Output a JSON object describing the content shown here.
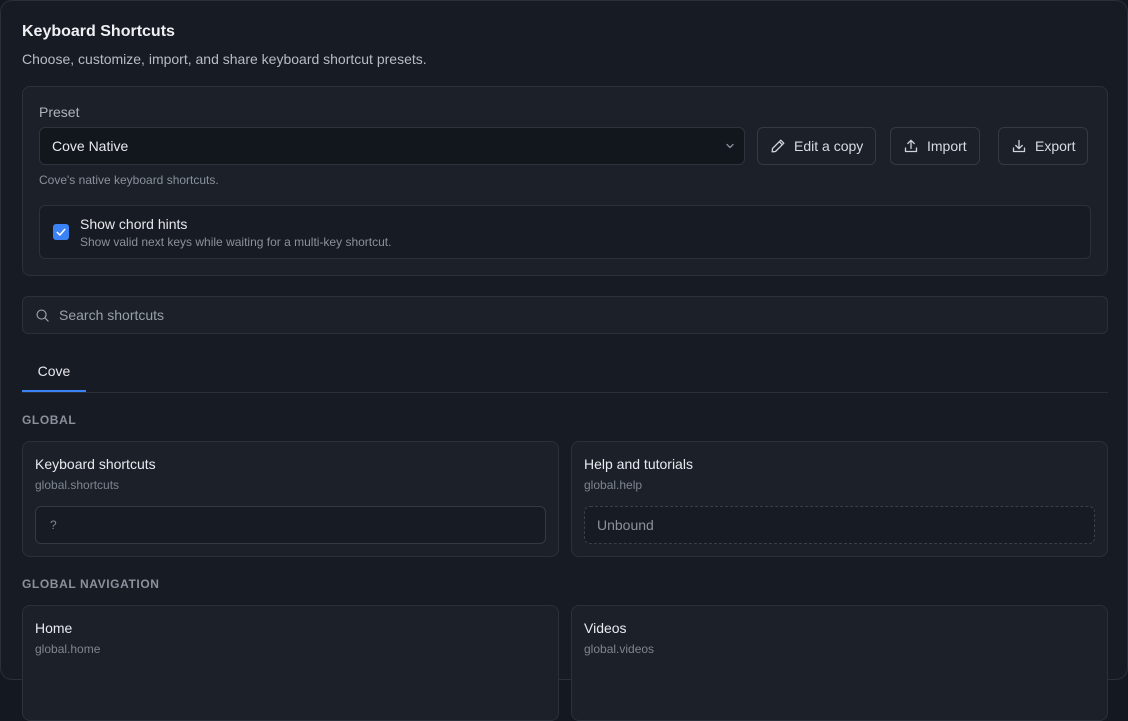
{
  "header": {
    "title": "Keyboard Shortcuts",
    "subtitle": "Choose, customize, import, and share keyboard shortcut presets."
  },
  "preset": {
    "label": "Preset",
    "selected": "Cove Native",
    "description": "Cove's native keyboard shortcuts.",
    "buttons": {
      "edit_copy": "Edit a copy",
      "import": "Import",
      "export": "Export"
    }
  },
  "chord_hints": {
    "checked": true,
    "title": "Show chord hints",
    "description": "Show valid next keys while waiting for a multi-key shortcut."
  },
  "search": {
    "placeholder": "Search shortcuts"
  },
  "tabs": [
    {
      "label": "Cove",
      "active": true
    }
  ],
  "sections": [
    {
      "heading": "GLOBAL",
      "items": [
        {
          "title": "Keyboard shortcuts",
          "id": "global.shortcuts",
          "binding": "?",
          "unbound": false
        },
        {
          "title": "Help and tutorials",
          "id": "global.help",
          "binding": "Unbound",
          "unbound": true
        }
      ]
    },
    {
      "heading": "GLOBAL NAVIGATION",
      "items": [
        {
          "title": "Home",
          "id": "global.home"
        },
        {
          "title": "Videos",
          "id": "global.videos"
        }
      ]
    }
  ],
  "colors": {
    "accent": "#3b82f6",
    "background": "#171b23",
    "card": "#1b2029"
  }
}
